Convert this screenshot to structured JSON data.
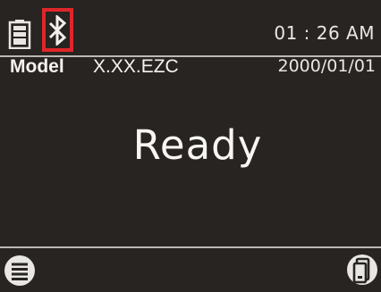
{
  "status_bar": {
    "battery_icon": "battery-full-icon",
    "bluetooth_icon": "bluetooth-icon",
    "bluetooth_highlight_color": "#e0262b",
    "time": "01 : 26 AM"
  },
  "info_row": {
    "model_label": "Model",
    "model_value": "X.XX.EZC",
    "date": "2000/01/01"
  },
  "main": {
    "status": "Ready"
  },
  "bottom_bar": {
    "menu_icon": "menu-icon",
    "device_icon": "device-icon"
  },
  "colors": {
    "background": "#282421",
    "text": "#f5f3f1",
    "divider": "#bdb8b3"
  }
}
